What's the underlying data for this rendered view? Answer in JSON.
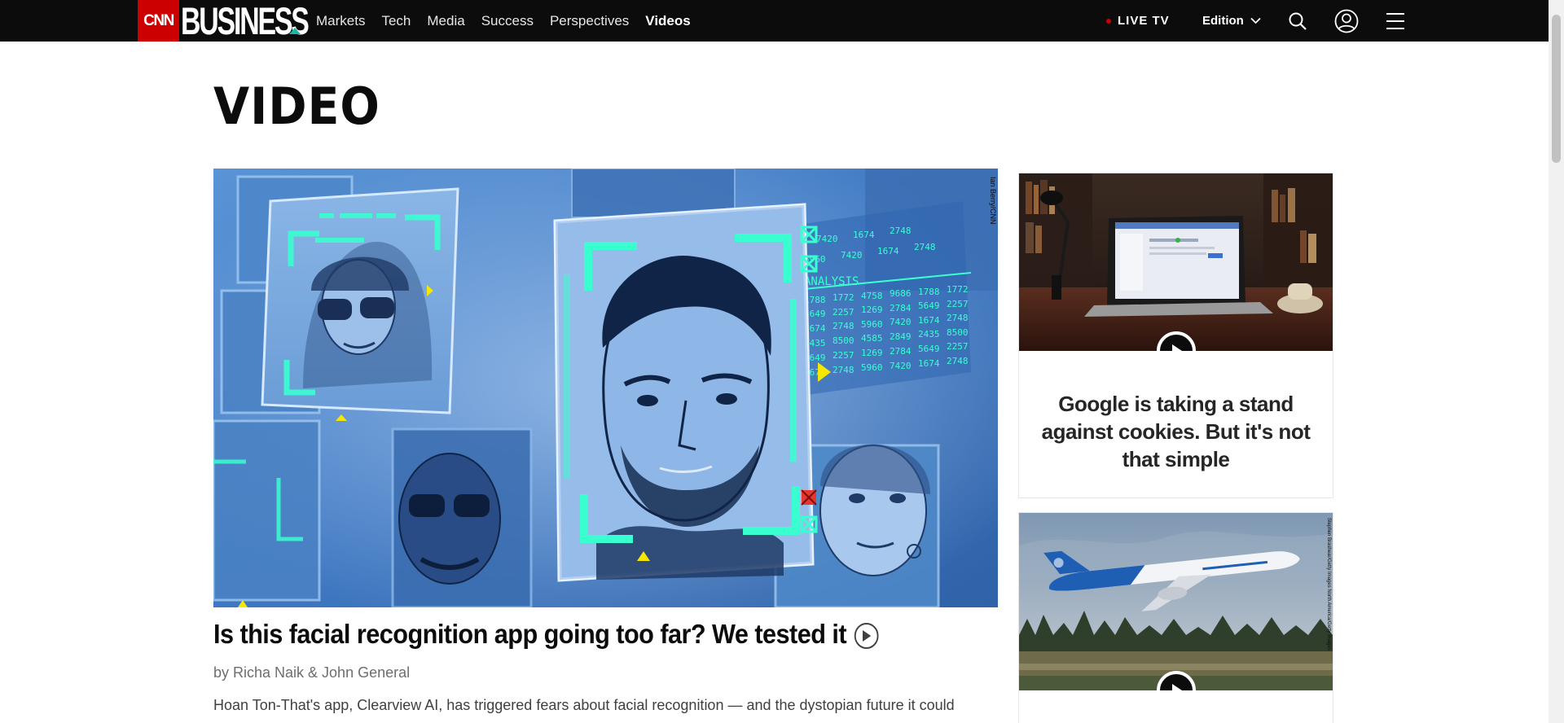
{
  "nav": {
    "logo_cnn": "CNN",
    "logo_business": "BUSINESS",
    "links": [
      "Markets",
      "Tech",
      "Media",
      "Success",
      "Perspectives",
      "Videos"
    ],
    "active_link": "Videos",
    "live_tv": "LIVE TV",
    "edition": "Edition",
    "icons": [
      "search-icon",
      "user-account-icon",
      "hamburger-menu-icon"
    ]
  },
  "page": {
    "title": "VIDEO"
  },
  "lead": {
    "title": "Is this facial recognition app going too far? We tested it",
    "byline": "by Richa Naik & John General",
    "description": "Hoan Ton-That's app, Clearview AI, has triggered fears about facial recognition — and the dystopian future it could",
    "image_credit": "Ian Berry/CNN",
    "image_numbers": [
      "7420",
      "1674",
      "2748",
      "5960",
      "7420",
      "1674",
      "2748",
      "ANALYSIS",
      "1788",
      "1772",
      "4758",
      "9686",
      "1788",
      "1772",
      "5649",
      "2257",
      "1269",
      "2784",
      "5649",
      "2257",
      "1674",
      "2748",
      "5960",
      "7420",
      "1674",
      "2748",
      "3435",
      "8500",
      "4585",
      "2849",
      "2435",
      "8500",
      "5649",
      "2257",
      "1269",
      "2784",
      "5649",
      "2257",
      "5674",
      "2748",
      "5960",
      "7420",
      "1674",
      "2748"
    ]
  },
  "cards": [
    {
      "title": "Google is taking a stand against cookies. But it's not that simple",
      "icon": "play-icon"
    },
    {
      "title": "",
      "icon": "play-icon",
      "image_credit": "Stephen Brashear/Getty Images North America/Getty Images"
    }
  ],
  "colors": {
    "nav_bg": "#0c0c0c",
    "cnn_red": "#cc0000",
    "accent_teal": "#1ab7a6",
    "neon_green": "#39ffd0"
  }
}
